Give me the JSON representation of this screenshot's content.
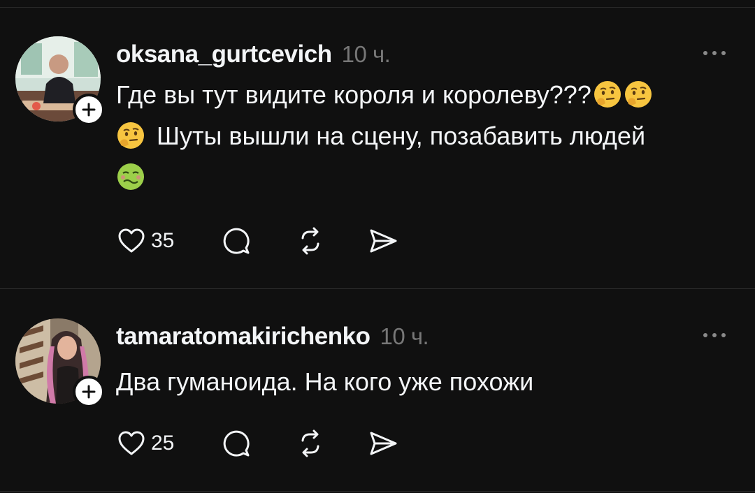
{
  "posts": [
    {
      "username": "oksana_gurtcevich",
      "time": "10 ч.",
      "text": "Где вы тут видите короля и королеву???",
      "text2": "Шуты вышли на сцену, позабавить людей",
      "emojis": [
        "thinking-face",
        "thinking-face",
        "thinking-face",
        "nauseated-face"
      ],
      "likes": "35"
    },
    {
      "username": "tamaratomakirichenko",
      "time": "10 ч.",
      "text": "Два гуманоида. На кого уже похожи",
      "likes": "25"
    }
  ],
  "colors": {
    "background": "#101010",
    "text": "#f3f5f7",
    "muted": "#777777",
    "divider": "#2e2e2e"
  }
}
